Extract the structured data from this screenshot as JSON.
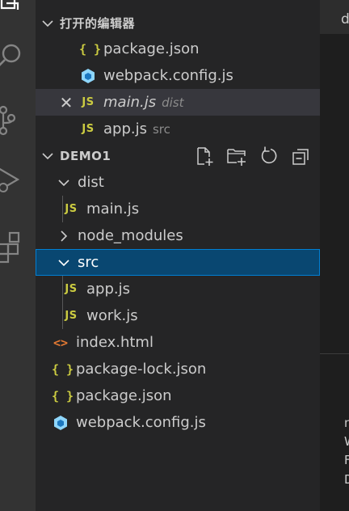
{
  "editor": {
    "tab_fragment": "d",
    "fragments": [
      "n",
      "W",
      "F",
      "D"
    ]
  },
  "open_editors": {
    "title": "打开的编辑器",
    "items": [
      {
        "icon": "json",
        "name": "package.json",
        "desc": ""
      },
      {
        "icon": "webpack",
        "name": "webpack.config.js",
        "desc": ""
      },
      {
        "icon": "js",
        "name": "main.js",
        "desc": "dist",
        "italic": true,
        "close": true
      },
      {
        "icon": "js",
        "name": "app.js",
        "desc": "src"
      }
    ]
  },
  "explorer": {
    "title": "DEMO1",
    "actions": [
      "new-file-icon",
      "new-folder-icon",
      "refresh-icon",
      "collapse-all-icon"
    ],
    "tree": [
      {
        "type": "folder",
        "name": "dist",
        "expanded": true,
        "depth": 1
      },
      {
        "type": "file",
        "icon": "js",
        "name": "main.js",
        "depth": 2
      },
      {
        "type": "folder",
        "name": "node_modules",
        "expanded": false,
        "depth": 1
      },
      {
        "type": "folder",
        "name": "src",
        "expanded": true,
        "depth": 1,
        "selected": true
      },
      {
        "type": "file",
        "icon": "js",
        "name": "app.js",
        "depth": 2
      },
      {
        "type": "file",
        "icon": "js",
        "name": "work.js",
        "depth": 2
      },
      {
        "type": "file",
        "icon": "html",
        "name": "index.html",
        "depth": 1
      },
      {
        "type": "file",
        "icon": "json",
        "name": "package-lock.json",
        "depth": 1
      },
      {
        "type": "file",
        "icon": "json",
        "name": "package.json",
        "depth": 1
      },
      {
        "type": "file",
        "icon": "webpack",
        "name": "webpack.config.js",
        "depth": 1
      }
    ]
  },
  "glyphs": {
    "json": "{ }",
    "js": "JS",
    "html": "<>",
    "close": "✕"
  },
  "colors": {
    "selection": "#094771",
    "selection_border": "#007fd4",
    "js": "#cbcb41",
    "html": "#e37933",
    "webpack": "#8ed6fb"
  }
}
